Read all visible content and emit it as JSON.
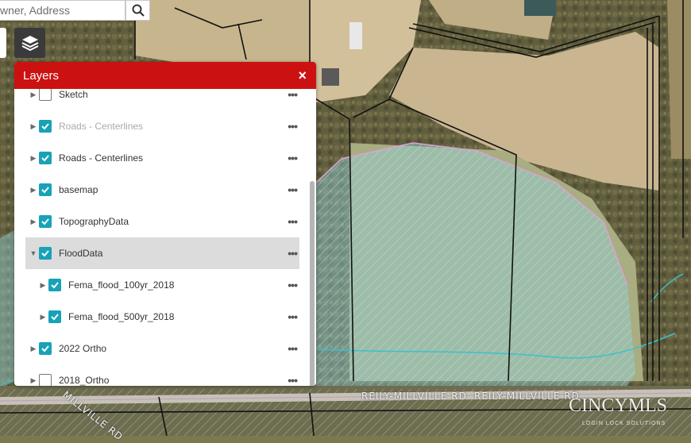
{
  "search": {
    "value": "wner, Address"
  },
  "panel": {
    "title": "Layers",
    "close_symbol": "×",
    "menu_symbol": "•••",
    "layers": [
      {
        "label": "Sketch",
        "checked": false,
        "dim": false,
        "indent": 0,
        "expanded": false,
        "selected": false
      },
      {
        "label": "Roads - Centerlines",
        "checked": true,
        "dim": true,
        "indent": 0,
        "expanded": false,
        "selected": false
      },
      {
        "label": "Roads - Centerlines",
        "checked": true,
        "dim": false,
        "indent": 0,
        "expanded": false,
        "selected": false
      },
      {
        "label": "basemap",
        "checked": true,
        "dim": false,
        "indent": 0,
        "expanded": false,
        "selected": false
      },
      {
        "label": "TopographyData",
        "checked": true,
        "dim": false,
        "indent": 0,
        "expanded": false,
        "selected": false
      },
      {
        "label": "FloodData",
        "checked": true,
        "dim": false,
        "indent": 0,
        "expanded": true,
        "selected": true
      },
      {
        "label": "Fema_flood_100yr_2018",
        "checked": true,
        "dim": false,
        "indent": 1,
        "expanded": false,
        "selected": false
      },
      {
        "label": "Fema_flood_500yr_2018",
        "checked": true,
        "dim": false,
        "indent": 1,
        "expanded": false,
        "selected": false
      },
      {
        "label": "2022 Ortho",
        "checked": true,
        "dim": false,
        "indent": 0,
        "expanded": false,
        "selected": false
      },
      {
        "label": "2018_Ortho",
        "checked": false,
        "dim": false,
        "indent": 0,
        "expanded": false,
        "selected": false
      }
    ]
  },
  "map": {
    "road_label_1": "REILY-MILLVILLE RD",
    "road_label_2": "REILY-MILLVILLE RD",
    "road_label_3": "MILLVILLE RD",
    "watermark": "CINCYMLS",
    "watermark_sub": "LOGIN   LOCK SOLUTIONS"
  },
  "colors": {
    "header": "#cc1111",
    "checkbox": "#17a2b8",
    "flood_fill": "#8fd0d8",
    "parcel_line": "#111111"
  }
}
